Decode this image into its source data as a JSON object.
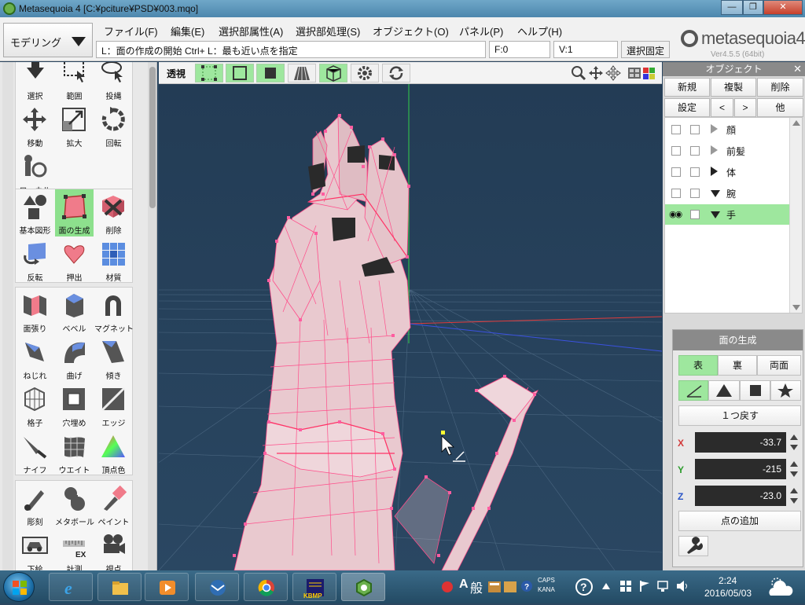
{
  "window": {
    "title": "Metasequoia 4 [C:¥pciture¥PSD¥003.mqo]",
    "min_label": "—",
    "max_label": "❐",
    "close_label": "✕"
  },
  "menubar": {
    "mode": "モデリング",
    "items": [
      "ファイル(F)",
      "編集(E)",
      "選択部属性(A)",
      "選択部処理(S)",
      "オブジェクト(O)",
      "パネル(P)",
      "ヘルプ(H)"
    ],
    "status_hint": "L：面の作成の開始  Ctrl+ L：最も近い点を指定",
    "face_count": "F:0",
    "vertex_count": "V:1",
    "selection_lock": "選択固定"
  },
  "logo": {
    "name": "metasequoia4",
    "version": "Ver4.5.5 (64bit)"
  },
  "toolbox": {
    "groups": [
      [
        {
          "label": "選択",
          "icon": "select-arrow-icon"
        },
        {
          "label": "範囲",
          "icon": "range-select-icon"
        },
        {
          "label": "投縄",
          "icon": "lasso-icon"
        },
        {
          "label": "移動",
          "icon": "move-icon"
        },
        {
          "label": "拡大",
          "icon": "scale-icon"
        },
        {
          "label": "回転",
          "icon": "rotate-icon"
        },
        {
          "label": "ローカル",
          "icon": "local-icon"
        }
      ],
      [
        {
          "label": "基本図形",
          "icon": "primitive-icon"
        },
        {
          "label": "面の生成",
          "icon": "create-face-icon",
          "selected": true
        },
        {
          "label": "削除",
          "icon": "delete-icon"
        },
        {
          "label": "反転",
          "icon": "flip-icon"
        },
        {
          "label": "押出",
          "icon": "extrude-icon"
        },
        {
          "label": "材質",
          "icon": "material-icon"
        }
      ],
      [
        {
          "label": "面張り",
          "icon": "face-fill-icon"
        },
        {
          "label": "ベベル",
          "icon": "bevel-icon"
        },
        {
          "label": "マグネット",
          "icon": "magnet-icon"
        },
        {
          "label": "ねじれ",
          "icon": "twist-icon"
        },
        {
          "label": "曲げ",
          "icon": "bend-icon"
        },
        {
          "label": "傾き",
          "icon": "tilt-icon"
        },
        {
          "label": "格子",
          "icon": "lattice-icon"
        },
        {
          "label": "穴埋め",
          "icon": "fill-hole-icon"
        },
        {
          "label": "エッジ",
          "icon": "edge-icon"
        },
        {
          "label": "ナイフ",
          "icon": "knife-icon"
        },
        {
          "label": "ウエイト",
          "icon": "weight-icon"
        },
        {
          "label": "頂点色",
          "icon": "vertex-color-icon"
        }
      ],
      [
        {
          "label": "彫刻",
          "icon": "sculpt-icon"
        },
        {
          "label": "メタボール",
          "icon": "metaball-icon"
        },
        {
          "label": "ペイント",
          "icon": "paint-icon"
        },
        {
          "label": "下絵",
          "icon": "underlay-icon"
        },
        {
          "label": "計測",
          "icon": "measure-icon"
        },
        {
          "label": "視点",
          "icon": "camera-icon"
        }
      ]
    ]
  },
  "viewport": {
    "mode_label": "透視",
    "buttons": [
      "vertex-mode-icon",
      "edge-mode-icon",
      "face-mode-icon",
      "perspective-icon",
      "box-icon",
      "gear-icon",
      "refresh-icon"
    ],
    "nav_icons": [
      "zoom-icon",
      "pan-icon",
      "orbit-icon",
      "layout-icon"
    ]
  },
  "object_panel": {
    "title": "オブジェクト",
    "buttons_row1": [
      "新規",
      "複製",
      "削除"
    ],
    "buttons_row2": [
      "設定",
      "<",
      ">",
      "他"
    ],
    "objects": [
      {
        "name": "顔",
        "arrow": "right-outline",
        "visible": false
      },
      {
        "name": "前髪",
        "arrow": "right-outline",
        "visible": false
      },
      {
        "name": "体",
        "arrow": "right-filled",
        "visible": false
      },
      {
        "name": "腕",
        "arrow": "down-filled",
        "visible": false
      },
      {
        "name": "手",
        "arrow": "down-filled",
        "visible": true,
        "selected": true
      }
    ],
    "eye_glyph": "◉◉"
  },
  "face_panel": {
    "title": "面の生成",
    "side_tabs": [
      "表",
      "裏",
      "両面"
    ],
    "shape_icons": [
      "angle-icon",
      "triangle-icon",
      "square-icon",
      "star-icon"
    ],
    "undo_label": "１つ戻す",
    "coords": [
      {
        "axis": "X",
        "value": "-33.7",
        "color": "#d23a3a"
      },
      {
        "axis": "Y",
        "value": "-215",
        "color": "#2c9c2c"
      },
      {
        "axis": "Z",
        "value": "-23.0",
        "color": "#2a55c8"
      }
    ],
    "add_point_label": "点の追加"
  },
  "taskbar": {
    "apps": [
      "ie-icon",
      "explorer-icon",
      "media-player-icon",
      "mail-icon",
      "chrome-icon",
      "kbmp-icon",
      "metasequoia-icon"
    ],
    "kbmp_label": "KBMP",
    "ime_a": "A",
    "ime_mode": "般",
    "caps": "CAPS",
    "kana": "KANA",
    "time": "2:24",
    "date": "2016/05/03"
  },
  "colors": {
    "accent_green": "#9ee79e",
    "viewport_bg": "#253f58",
    "mesh": "#ff4d8a"
  }
}
